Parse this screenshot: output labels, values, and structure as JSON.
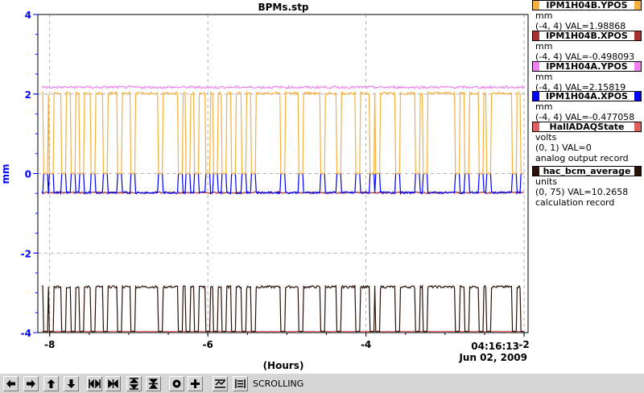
{
  "chart_data": {
    "type": "line",
    "title": "BPMs.stp",
    "xlabel": "(Hours)",
    "ylabel": "mm",
    "xlim": [
      -8.15,
      -1.95
    ],
    "ylim": [
      -4,
      4
    ],
    "x_ticks": [
      "-8",
      "-6",
      "-4",
      "-2"
    ],
    "y_ticks": [
      "-4",
      "-2",
      "0",
      "2",
      "4"
    ],
    "time_label": "04:16:13",
    "date_label": "Jun 02, 2009",
    "grid": true,
    "series": [
      {
        "name": "IPM1H04B.YPOS",
        "color": "#f5b040",
        "baseline": 2.02,
        "drop_to": 0.0
      },
      {
        "name": "IPM1H04B.XPOS",
        "color": "#a83030",
        "baseline": -0.48
      },
      {
        "name": "IPM1H04A.YPOS",
        "color": "#ee82ee",
        "baseline": 2.17
      },
      {
        "name": "IPM1H04A.XPOS",
        "color": "#0000ff",
        "baseline": -0.48,
        "spike_to": 0.0
      },
      {
        "name": "HallADAQState",
        "color": "#e06060",
        "baseline": -3.97
      },
      {
        "name": "hac_bcm_average",
        "color": "#2a1208",
        "baseline": -2.85,
        "drop_to": -3.97
      }
    ],
    "events": [
      -8.05,
      -7.98,
      -7.82,
      -7.7,
      -7.6,
      -7.45,
      -7.3,
      -7.12,
      -6.95,
      -6.6,
      -6.35,
      -6.25,
      -6.15,
      -6.0,
      -5.9,
      -5.8,
      -5.68,
      -5.55,
      -5.42,
      -5.05,
      -4.82,
      -4.55,
      -4.35,
      -4.1,
      -3.92,
      -3.85,
      -3.6,
      -3.35,
      -3.25,
      -2.85,
      -2.72,
      -2.55,
      -2.45,
      -2.12,
      -2.02
    ]
  },
  "legend": [
    {
      "name": "IPM1H04B.YPOS",
      "color": "#f5b040",
      "unit": "mm",
      "range": "(-4, 4) VAL=1.98868",
      "type": ""
    },
    {
      "name": "IPM1H04B.XPOS",
      "color": "#a83030",
      "unit": "mm",
      "range": "(-4, 4) VAL=-0.498093",
      "type": ""
    },
    {
      "name": "IPM1H04A.YPOS",
      "color": "#ee82ee",
      "unit": "mm",
      "range": "(-4, 4) VAL=2.15819",
      "type": ""
    },
    {
      "name": "IPM1H04A.XPOS",
      "color": "#0000ff",
      "unit": "mm",
      "range": "(-4, 4) VAL=-0.477058",
      "type": ""
    },
    {
      "name": "HallADAQState",
      "color": "#e06060",
      "unit": "volts",
      "range": "(0, 1) VAL=0",
      "type": "analog output record"
    },
    {
      "name": "hac_bcm_average",
      "color": "#2a1208",
      "unit": "units",
      "range": "(0, 75) VAL=10.2658",
      "type": "calculation record"
    }
  ],
  "toolbar": {
    "status": "SCROLLING",
    "buttons": [
      "pan-left-icon",
      "pan-right-icon",
      "pan-up-icon",
      "pan-down-icon",
      "zoom-in-x-icon",
      "zoom-out-x-icon",
      "zoom-in-y-icon",
      "zoom-out-y-icon",
      "config-icon",
      "add-icon",
      "scroll-mode-icon",
      "stagger-icon"
    ]
  }
}
